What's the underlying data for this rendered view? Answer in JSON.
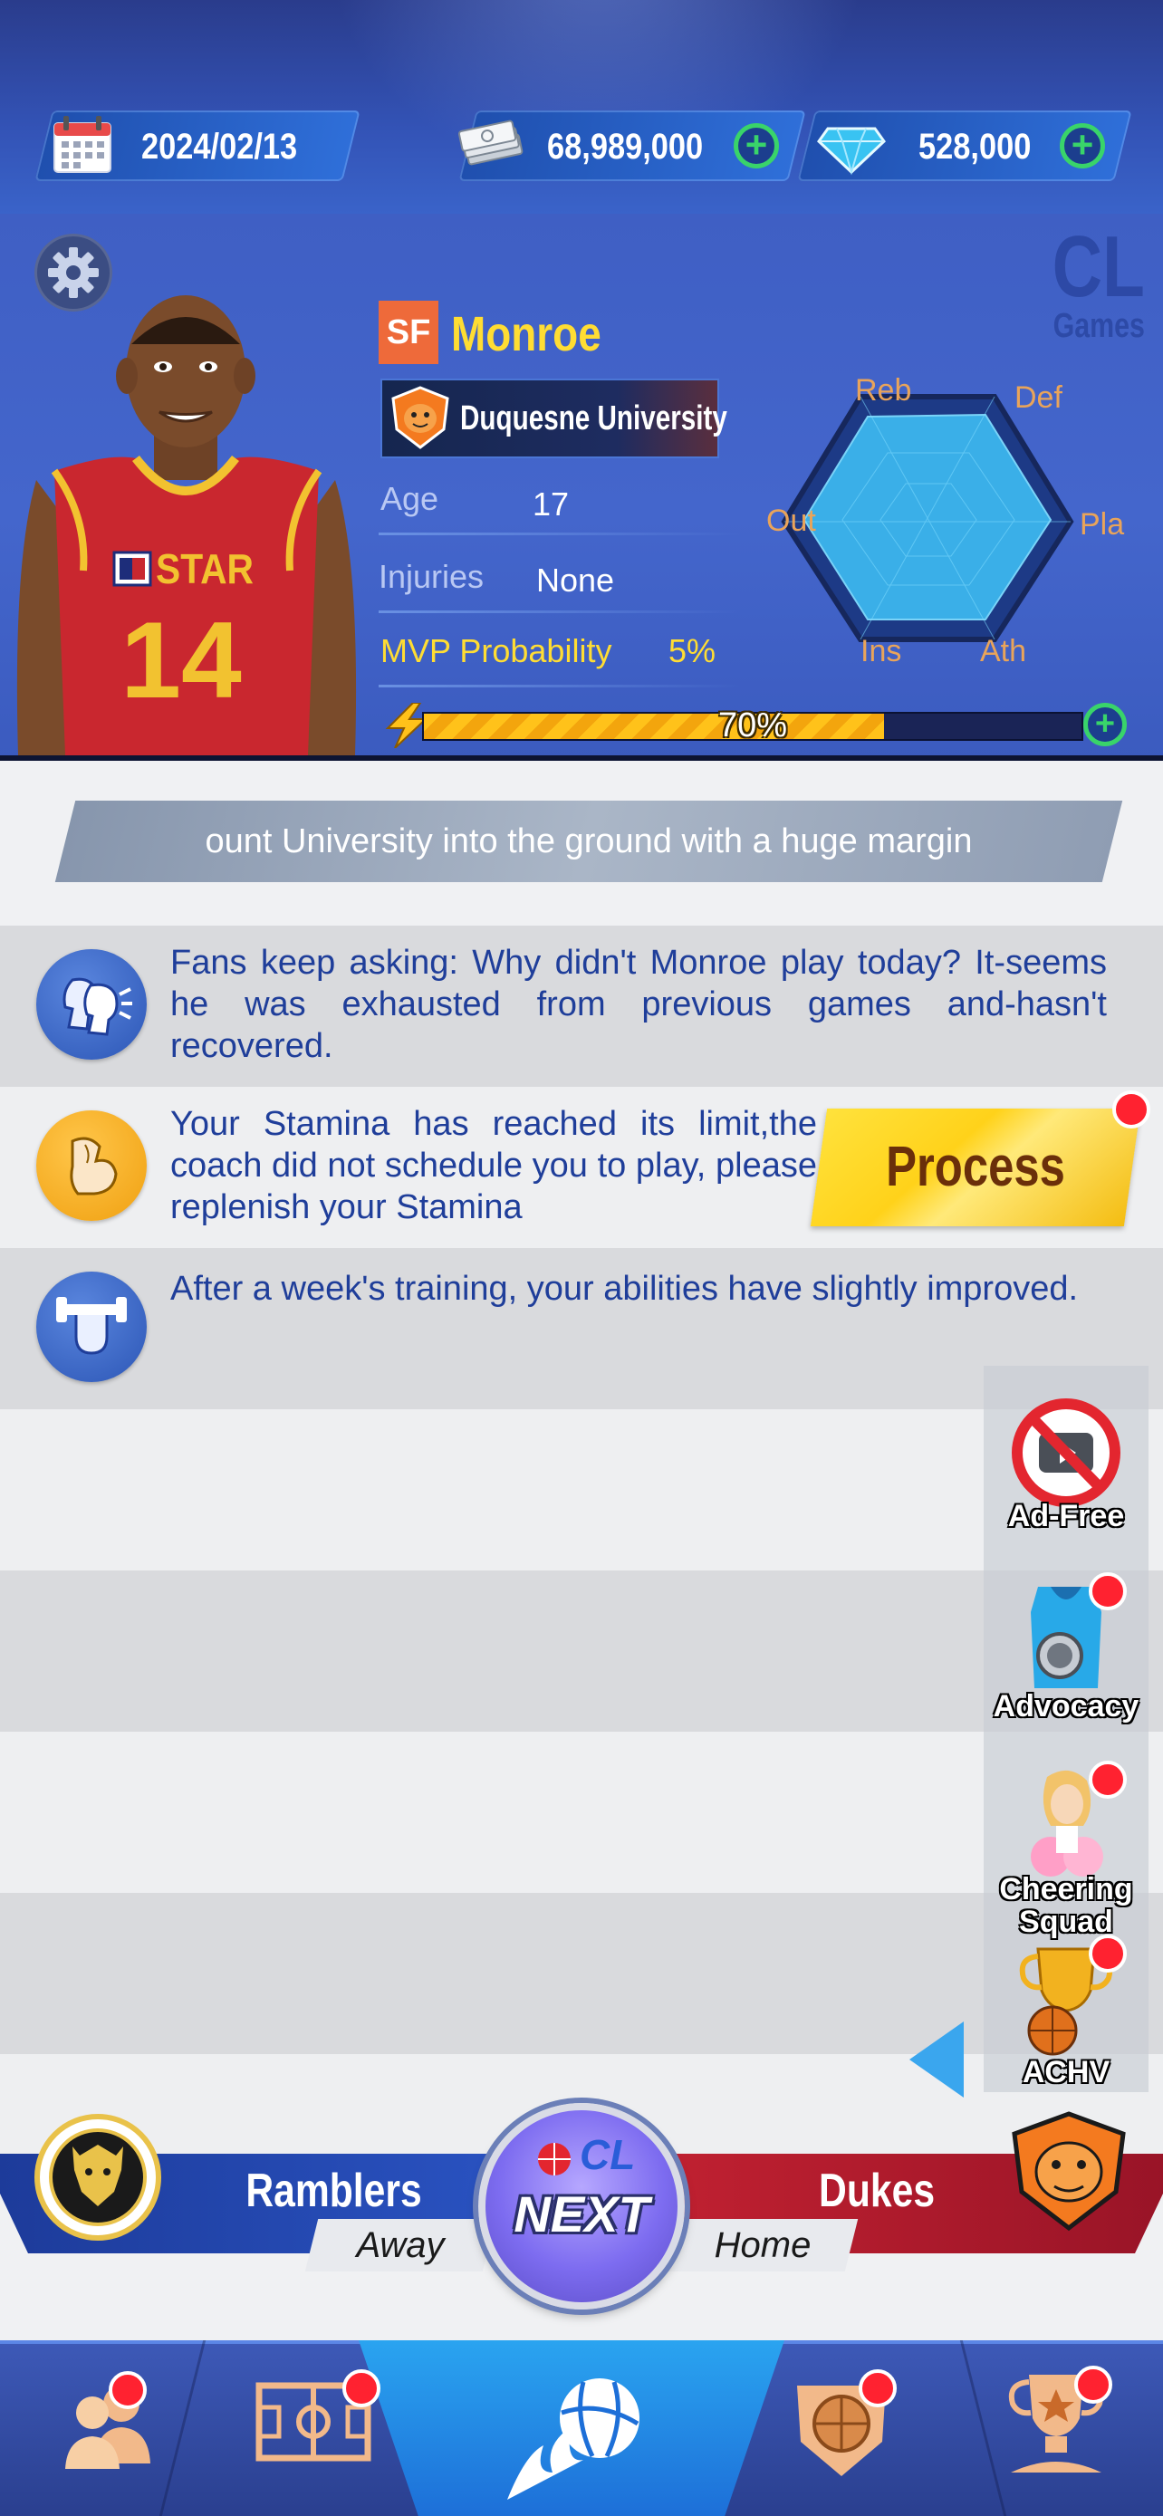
{
  "topbar": {
    "date": "2024/02/13",
    "cash": "68,989,000",
    "diamonds": "528,000"
  },
  "player": {
    "position": "SF",
    "name": "Monroe",
    "university": "Duquesne University",
    "jersey_text": "STAR",
    "jersey_number": "14",
    "age_label": "Age",
    "age_value": "17",
    "injuries_label": "Injuries",
    "injuries_value": "None",
    "mvp_label": "MVP Probability",
    "mvp_value": "5%",
    "stamina": "70%",
    "stamina_fraction": 0.7,
    "watermark": [
      "CL",
      "Games"
    ],
    "radar_labels": [
      "Reb",
      "Def",
      "Pla",
      "Ath",
      "Ins",
      "Out"
    ]
  },
  "feed": {
    "banner": "ount University into the ground with a huge margin",
    "items": [
      {
        "icon": "fans-talking-icon",
        "text": "Fans keep asking: Why didn't Monroe play today? It-seems he was exhausted from previous games and-hasn't recovered."
      },
      {
        "icon": "tired-arm-icon",
        "text": "Your Stamina has reached its limit,the coach did not schedule you to play, please replenish your Stamina"
      },
      {
        "icon": "dumbbell-icon",
        "text": "After a week's training, your abilities have slightly improved."
      }
    ],
    "process_label": "Process"
  },
  "side_menu": [
    {
      "label": "Ad-Free"
    },
    {
      "label": "Advocacy"
    },
    {
      "label": "Cheering Squad"
    },
    {
      "label": "ACHV"
    }
  ],
  "match": {
    "away_team": "Ramblers",
    "away_label": "Away",
    "home_team": "Dukes",
    "home_label": "Home",
    "next_label": "NEXT",
    "next_logo": "CL"
  },
  "colors": {
    "accent_yellow": "#ffdd33",
    "badge_orange": "#ee6a3a",
    "feed_text": "#1f3e9a",
    "plus_green": "#39d46a",
    "notification_red": "#ff2230"
  }
}
